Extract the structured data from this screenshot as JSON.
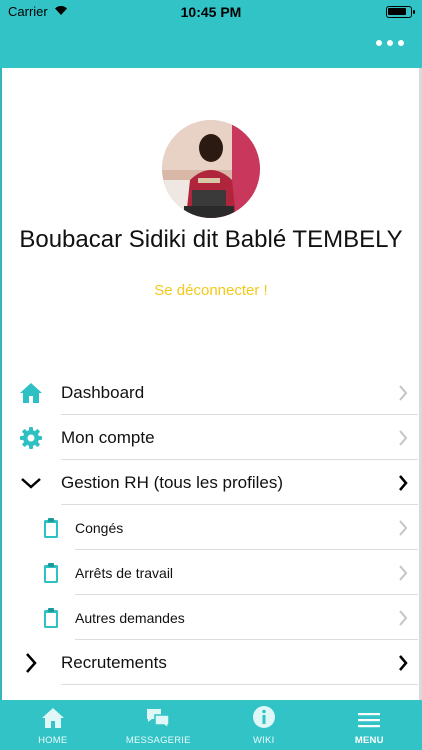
{
  "status_bar": {
    "carrier": "Carrier",
    "time": "10:45 PM"
  },
  "profile": {
    "name": "Boubacar Sidiki dit Bablé TEMBELY",
    "logout_label": "Se déconnecter !"
  },
  "menu": {
    "items": [
      {
        "label": "Dashboard",
        "icon": "home-icon"
      },
      {
        "label": "Mon compte",
        "icon": "gear-icon"
      },
      {
        "label": "Gestion RH (tous les profiles)",
        "icon": "chevron-down-icon",
        "expanded": true
      },
      {
        "label": "Congés",
        "icon": "clipboard-icon"
      },
      {
        "label": "Arrêts de travail",
        "icon": "clipboard-icon"
      },
      {
        "label": "Autres demandes",
        "icon": "clipboard-icon"
      },
      {
        "label": "Recrutements",
        "icon": "chevron-right-icon",
        "expanded": false
      }
    ]
  },
  "tab_bar": {
    "tabs": [
      {
        "label": "HOME",
        "icon": "home-icon"
      },
      {
        "label": "MESSAGERIE",
        "icon": "chat-icon"
      },
      {
        "label": "WIKI",
        "icon": "info-icon"
      },
      {
        "label": "MENU",
        "icon": "hamburger-icon",
        "active": true
      }
    ]
  },
  "colors": {
    "accent": "#32c3c6",
    "logout": "#f4c91a",
    "icon": "#2fc0c4"
  }
}
